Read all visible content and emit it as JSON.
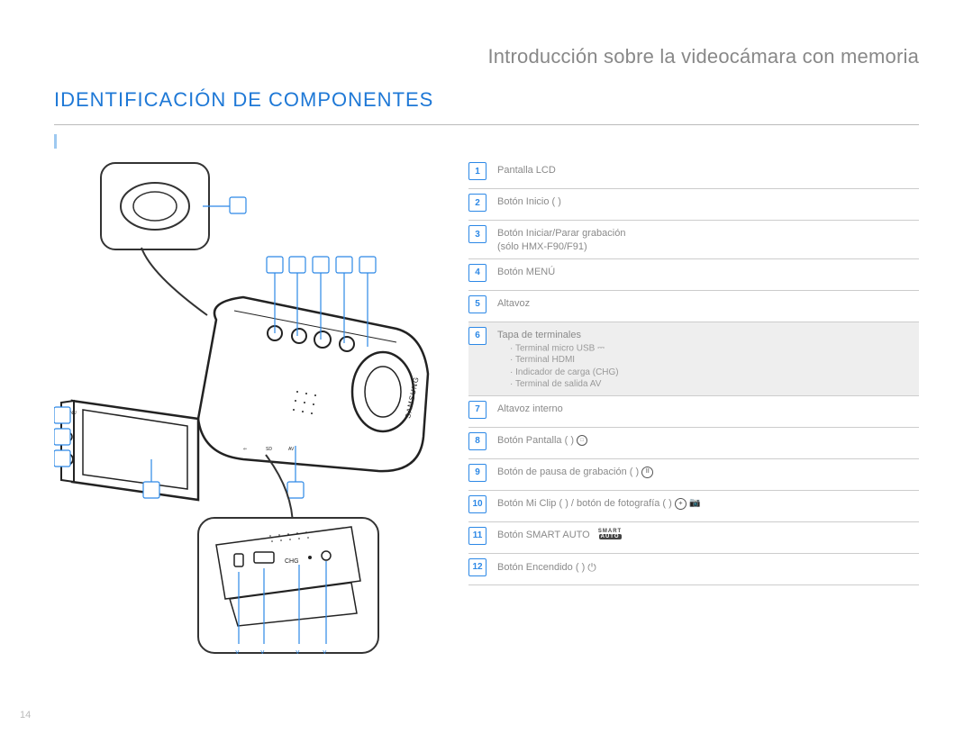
{
  "pretitle": "Introducción sobre la videocámara con memoria",
  "title": "IDENTIFICACIÓN DE COMPONENTES",
  "subtitle_marker": " ",
  "page_number": "14",
  "legend": [
    {
      "n": "1",
      "text": "Pantalla LCD"
    },
    {
      "n": "2",
      "text": "Botón Inicio ( )"
    },
    {
      "n": "3",
      "text": "Botón Iniciar/Parar grabación",
      "extra": "(sólo HMX-F90/F91)"
    },
    {
      "n": "4",
      "text": "Botón MENÚ"
    },
    {
      "n": "5",
      "text": "Altavoz"
    },
    {
      "n": "6",
      "text": "Tapa de terminales",
      "sub": [
        {
          "lead": "·",
          "label": "Terminal micro USB",
          "sym": "usb"
        },
        {
          "lead": "·",
          "label": "Terminal HDMI",
          "sym": ""
        },
        {
          "lead": "·",
          "label": "Indicador de carga (CHG)",
          "sym": ""
        },
        {
          "lead": "·",
          "label": "Terminal de salida AV",
          "sym": ""
        }
      ]
    },
    {
      "n": "7",
      "text": "Altavoz interno"
    },
    {
      "n": "8",
      "text": "Botón Pantalla ( )",
      "sym": "disp"
    },
    {
      "n": "9",
      "text": "Botón de pausa de grabación ( )",
      "sym": "pause"
    },
    {
      "n": "10",
      "text": "Botón Mi Clip ( ) / botón de fotografía ( )",
      "sym": "clip"
    },
    {
      "n": "11",
      "text": "Botón SMART AUTO",
      "sym": "smartauto"
    },
    {
      "n": "12",
      "text": "Botón Encendido ( )",
      "sym": "power"
    }
  ]
}
